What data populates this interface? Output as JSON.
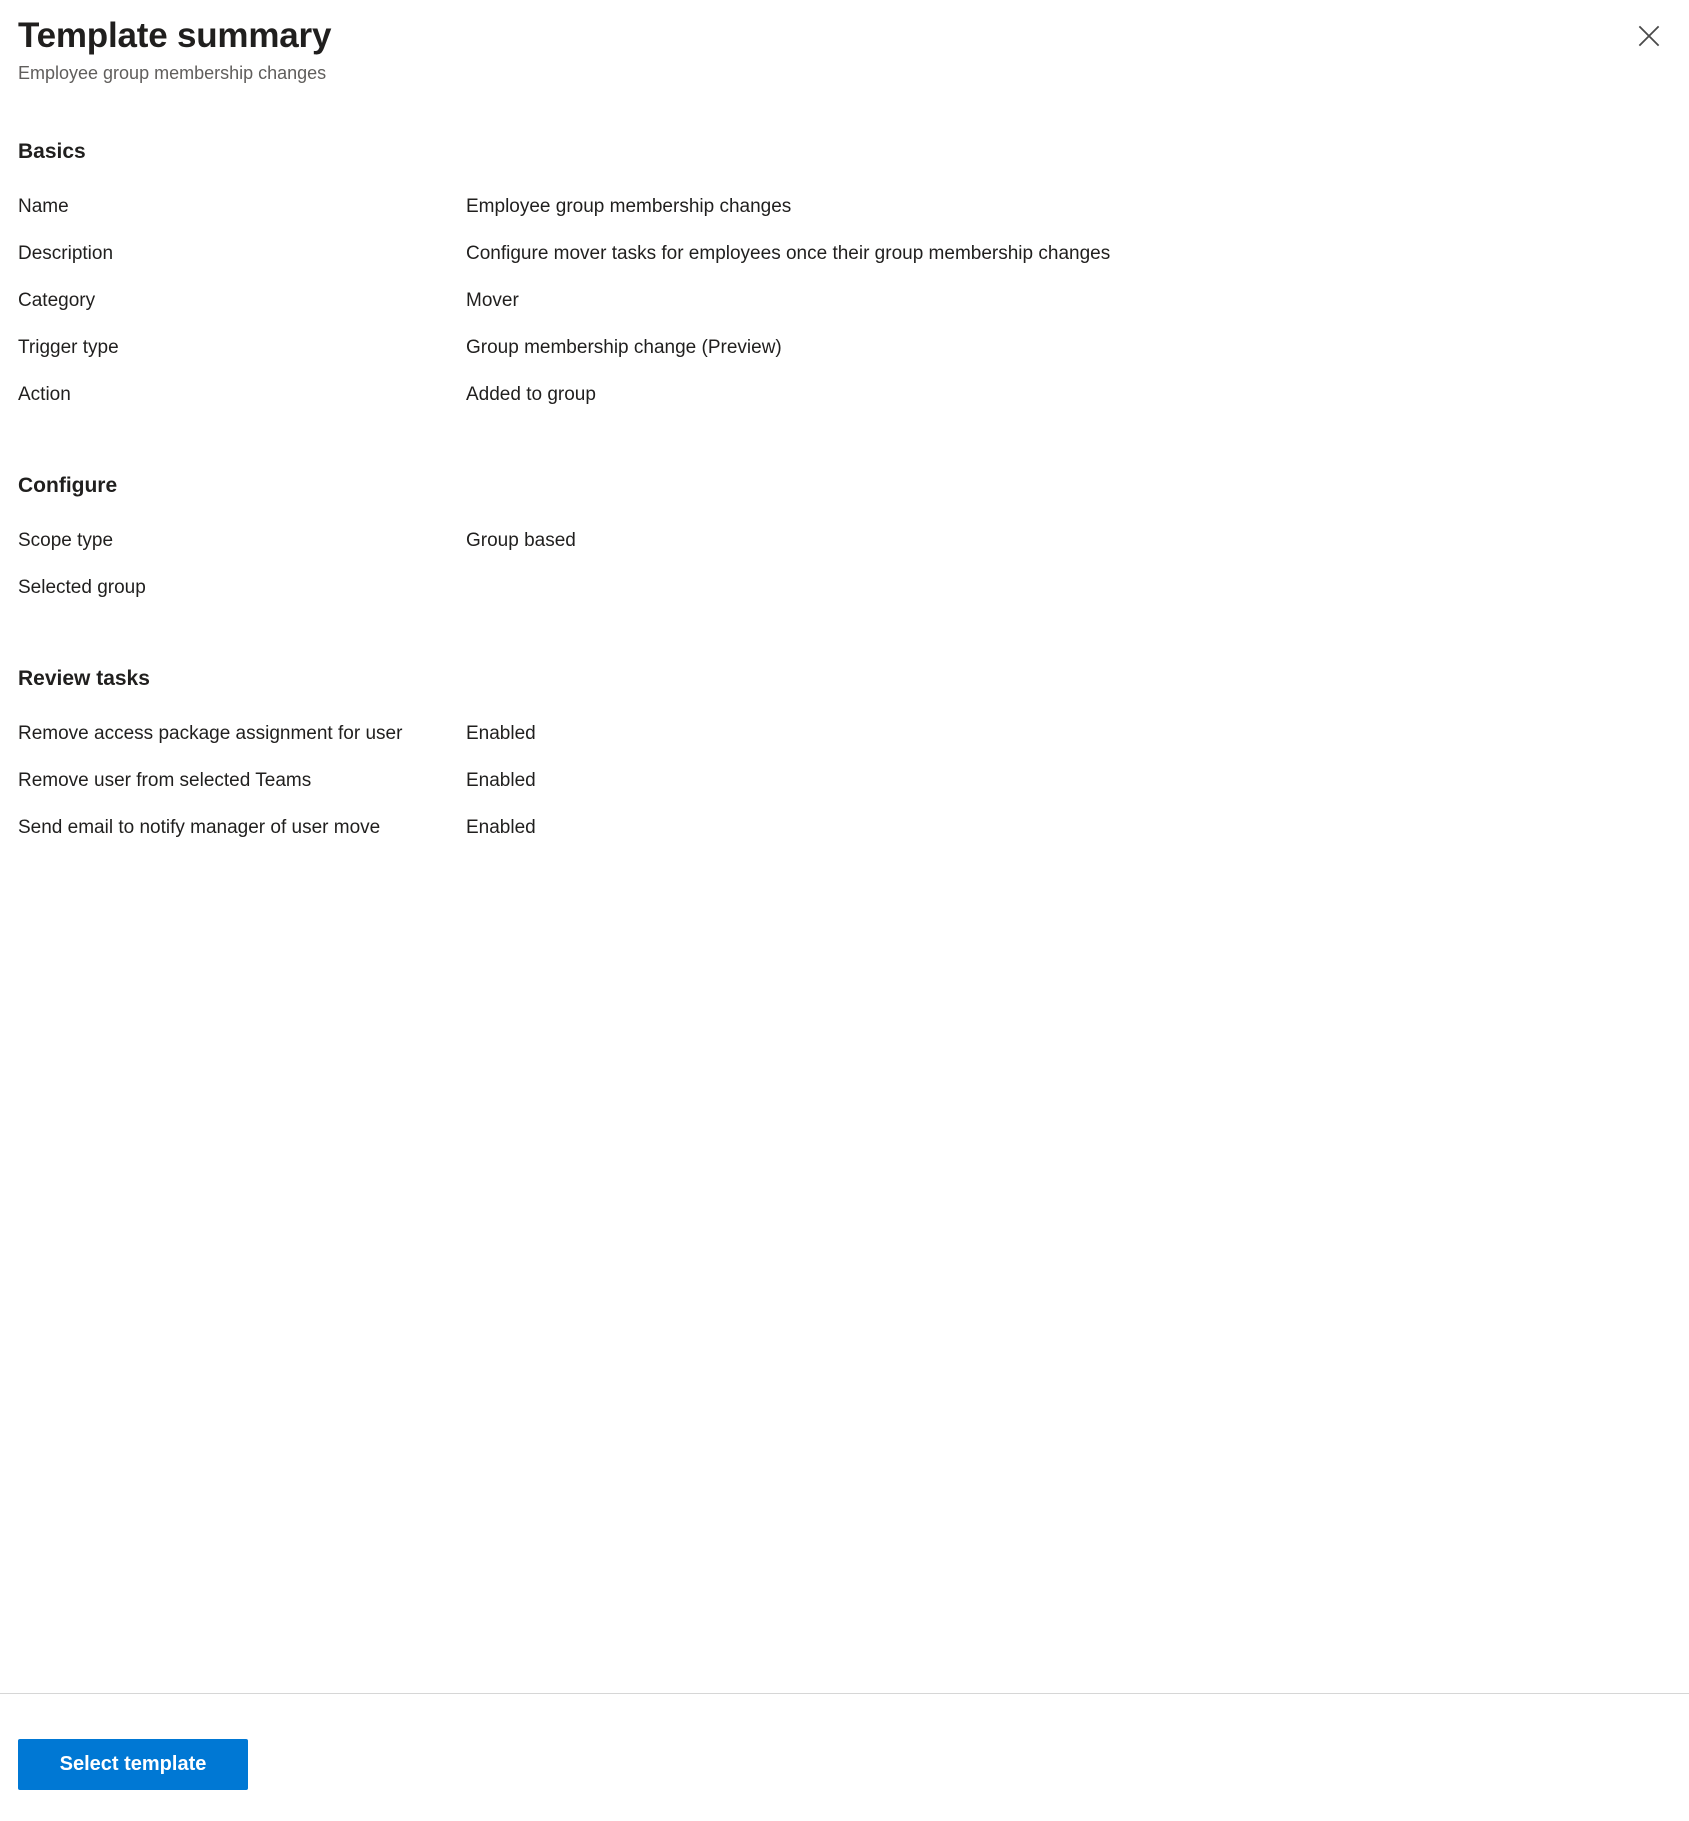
{
  "header": {
    "title": "Template summary",
    "subtitle": "Employee group membership changes",
    "close_icon": "close-icon"
  },
  "sections": [
    {
      "id": "basics",
      "heading": "Basics",
      "rows": [
        {
          "label": "Name",
          "value": "Employee group membership changes"
        },
        {
          "label": "Description",
          "value": "Configure mover tasks for employees once their group membership changes"
        },
        {
          "label": "Category",
          "value": "Mover"
        },
        {
          "label": "Trigger type",
          "value": "Group membership change (Preview)"
        },
        {
          "label": "Action",
          "value": "Added to group"
        }
      ]
    },
    {
      "id": "configure",
      "heading": "Configure",
      "rows": [
        {
          "label": "Scope type",
          "value": "Group based"
        },
        {
          "label": "Selected group",
          "value": ""
        }
      ]
    },
    {
      "id": "review-tasks",
      "heading": "Review tasks",
      "rows": [
        {
          "label": "Remove access package assignment for user",
          "value": "Enabled"
        },
        {
          "label": "Remove user from selected Teams",
          "value": "Enabled"
        },
        {
          "label": "Send email to notify manager of user move",
          "value": "Enabled"
        }
      ]
    }
  ],
  "footer": {
    "primary_button_label": "Select template"
  },
  "colors": {
    "accent": "#0078d4",
    "text": "#201f1e",
    "subtle_text": "#605e5c",
    "divider": "#d6d6d6",
    "background": "#ffffff"
  }
}
